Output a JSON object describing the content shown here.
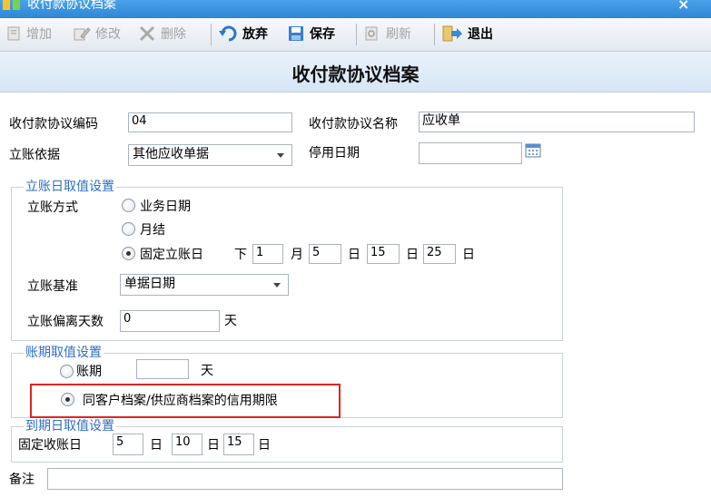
{
  "window": {
    "title": "收付款协议档案",
    "close_glyph": "✕",
    "close_label": "×"
  },
  "toolbar": {
    "add_label": "增加",
    "edit_label": "修改",
    "delete_label": "删除",
    "abandon_label": "放弃",
    "save_label": "保存",
    "refresh_label": "刷新",
    "exit_label": "退出"
  },
  "page": {
    "title": "收付款协议档案"
  },
  "form": {
    "code_label": "收付款协议编码",
    "code_value": "04",
    "name_label": "收付款协议名称",
    "name_value": "应收单",
    "basis_label": "立账依据",
    "basis_value": "其他应收单据",
    "disable_date_label": "停用日期",
    "disable_date_value": ""
  },
  "posting_date": {
    "legend": "立账日取值设置",
    "method_label": "立账方式",
    "options": [
      "业务日期",
      "月结",
      "固定立账日"
    ],
    "selected": "固定立账日",
    "lower": "下",
    "month_value": "1",
    "month_unit": "月",
    "day1_value": "5",
    "day_unit": "日",
    "day2_value": "15",
    "day3_value": "25",
    "standard_label": "立账基准",
    "standard_value": "单据日期",
    "offset_label": "立账偏离天数",
    "offset_value": "0",
    "offset_unit": "天"
  },
  "term": {
    "legend": "账期取值设置",
    "period_label": "账期",
    "period_value": "",
    "period_unit": "天",
    "credit_label": "同客户档案/供应商档案的信用期限",
    "selected": "同客户档案/供应商档案的信用期限"
  },
  "due": {
    "legend": "到期日取值设置",
    "label": "固定收账日",
    "day1_value": "5",
    "day2_value": "10",
    "day3_value": "15",
    "unit": "日"
  },
  "remark": {
    "label": "备注",
    "value": ""
  },
  "colors": {
    "titlebar": "#2f86d6",
    "legend": "#2f6ec4",
    "highlight": "#e02424"
  }
}
